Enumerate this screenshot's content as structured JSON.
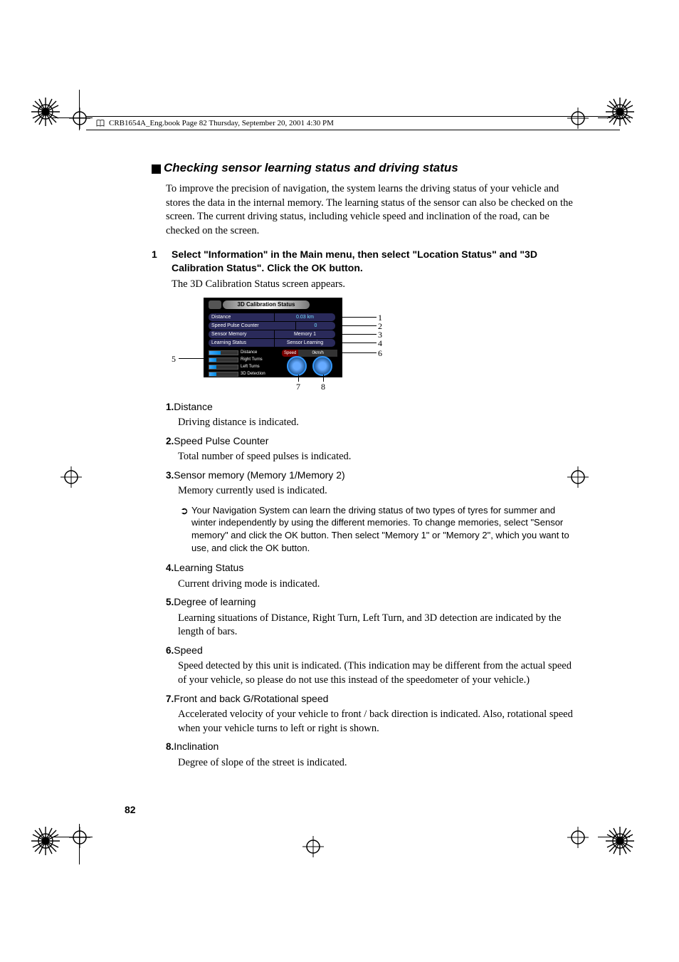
{
  "header": {
    "text": "CRB1654A_Eng.book  Page 82  Thursday, September 20, 2001  4:30 PM"
  },
  "section": {
    "title": "Checking sensor learning status and driving status",
    "intro": "To improve the precision of navigation, the system learns the driving status of your vehicle and stores the data in the internal memory. The learning status of the sensor can also be checked on the screen. The current driving status, including vehicle speed and inclination of the road, can be checked on the screen.",
    "step": {
      "num": "1",
      "text": "Select \"Information\" in the Main menu, then select \"Location Status\" and \"3D Calibration Status\". Click the OK button.",
      "followup": "The 3D Calibration Status screen appears."
    },
    "figure": {
      "title": "3D Calibration Status",
      "rows": [
        {
          "label": "Distance",
          "val": "0.03 km"
        },
        {
          "label": "Speed Pulse Counter",
          "val": "0"
        },
        {
          "label": "Sensor Memory",
          "val": "Memory 1"
        },
        {
          "label": "Learning  Status",
          "val": "Sensor Learning"
        }
      ],
      "bars": [
        {
          "label": "Distance"
        },
        {
          "label": "Right Turns"
        },
        {
          "label": "Left Turns"
        },
        {
          "label": "3D Detection"
        }
      ],
      "speed": {
        "label": "Speed",
        "val": "0km/h"
      },
      "callouts_right": [
        "1",
        "2",
        "3",
        "4",
        "6"
      ],
      "callout_left": "5",
      "callouts_bottom": [
        "7",
        "8"
      ]
    },
    "items": [
      {
        "num": "1.",
        "title": "Distance",
        "desc": "Driving distance is indicated."
      },
      {
        "num": "2.",
        "title": "Speed Pulse Counter",
        "desc": "Total number of speed pulses is indicated."
      },
      {
        "num": "3.",
        "title": "Sensor memory (Memory 1/Memory 2)",
        "desc": "Memory currently used is indicated.",
        "note": "Your Navigation System can learn the driving status of two types of tyres for summer and winter independently by using the different memories. To change memories, select \"Sensor memory\" and click the OK button. Then select \"Memory 1\" or \"Memory 2\", which you want to use, and click the OK button."
      },
      {
        "num": "4.",
        "title": "Learning Status",
        "desc": "Current driving mode is indicated."
      },
      {
        "num": "5.",
        "title": "Degree of learning",
        "desc": "Learning situations of Distance, Right Turn, Left Turn, and 3D detection are indicated by the length of bars."
      },
      {
        "num": "6.",
        "title": "Speed",
        "desc": "Speed detected by this unit is indicated. (This indication may be different from the actual speed of your vehicle, so please do not use this instead of the speedometer of your vehicle.)"
      },
      {
        "num": "7.",
        "title": "Front and back G/Rotational speed",
        "desc": "Accelerated velocity of your vehicle to front / back direction is indicated. Also, rotational speed when your vehicle turns to left or right is shown."
      },
      {
        "num": "8.",
        "title": "Inclination",
        "desc": "Degree of slope of the street is indicated."
      }
    ]
  },
  "pageNumber": "82"
}
